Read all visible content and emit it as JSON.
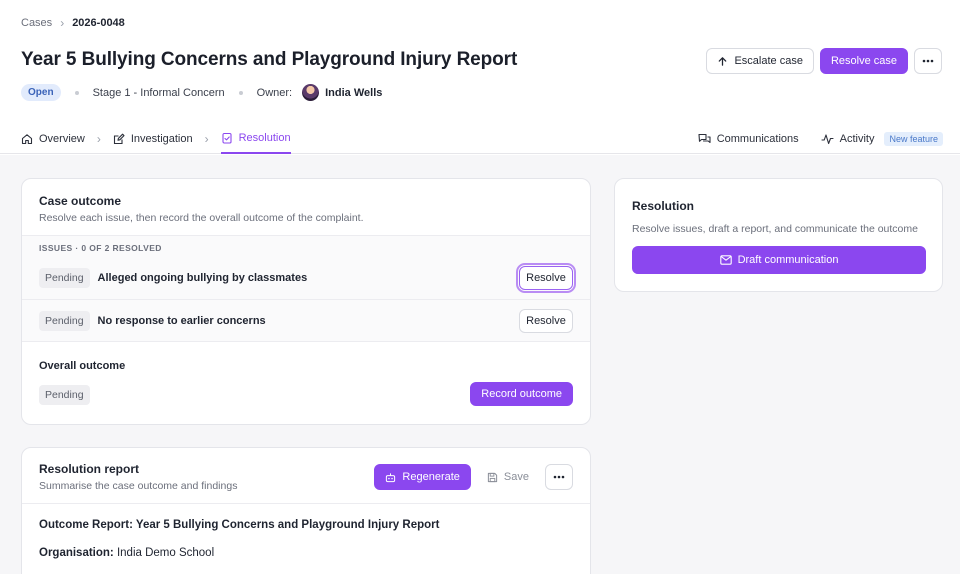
{
  "breadcrumb": {
    "root": "Cases",
    "current": "2026-0048"
  },
  "page": {
    "title": "Year 5 Bullying Concerns and Playground Injury Report"
  },
  "actions": {
    "escalate_label": "Escalate case",
    "resolve_label": "Resolve case"
  },
  "meta": {
    "status": "Open",
    "stage": "Stage 1 - Informal Concern",
    "owner_label": "Owner:",
    "owner_name": "India Wells"
  },
  "tabs": [
    {
      "label": "Overview",
      "icon": "home-icon"
    },
    {
      "label": "Investigation",
      "icon": "edit-icon"
    },
    {
      "label": "Resolution",
      "icon": "checklist-icon",
      "active": true
    }
  ],
  "tabs_right": {
    "communications": "Communications",
    "activity": "Activity",
    "new_badge": "New feature"
  },
  "outcome": {
    "title": "Case outcome",
    "subtitle": "Resolve each issue, then record the overall outcome of the complaint.",
    "issues_label": "ISSUES · 0 OF 2 RESOLVED",
    "issues": [
      {
        "status": "Pending",
        "text": "Alleged ongoing bullying by classmates",
        "action": "Resolve"
      },
      {
        "status": "Pending",
        "text": "No response to earlier concerns",
        "action": "Resolve"
      }
    ],
    "overall_title": "Overall outcome",
    "overall_status": "Pending",
    "record_label": "Record outcome"
  },
  "report": {
    "title": "Resolution report",
    "subtitle": "Summarise the case outcome and findings",
    "regenerate_label": "Regenerate",
    "save_label": "Save",
    "heading": "Outcome Report: Year 5 Bullying Concerns and Playground Injury Report",
    "org_label": "Organisation:",
    "org_value": "India Demo School"
  },
  "resolution_panel": {
    "title": "Resolution",
    "description": "Resolve issues, draft a report, and communicate the outcome",
    "draft_label": "Draft communication"
  },
  "colors": {
    "accent": "#8b47ef",
    "open_badge_bg": "#e2ebfc",
    "open_badge_text": "#3b63b8"
  }
}
